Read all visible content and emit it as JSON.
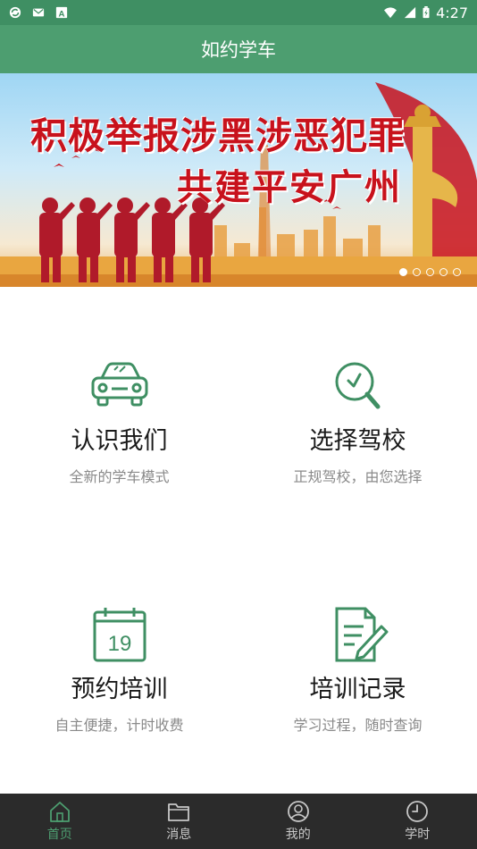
{
  "status_bar": {
    "left_icons": [
      "sync-icon",
      "mail-icon",
      "text-a-icon"
    ],
    "time": "4:27",
    "right_icons": [
      "wifi-icon",
      "signal-icon",
      "battery-icon"
    ]
  },
  "app_bar": {
    "title": "如约学车"
  },
  "banner": {
    "line1": "积极举报涉黑涉恶犯罪",
    "line2": "共建平安广州",
    "dot_count": 5,
    "active_dot_index": 0
  },
  "tiles": [
    {
      "icon": "car-icon",
      "title": "认识我们",
      "subtitle": "全新的学车模式"
    },
    {
      "icon": "search-icon",
      "title": "选择驾校",
      "subtitle": "正规驾校，由您选择"
    },
    {
      "icon": "calendar-icon",
      "title": "预约培训",
      "subtitle": "自主便捷，计时收费",
      "calendar_number": "19"
    },
    {
      "icon": "notes-icon",
      "title": "培训记录",
      "subtitle": "学习过程，随时查询"
    }
  ],
  "tab_bar": {
    "items": [
      {
        "icon": "home-icon",
        "label": "首页",
        "active": true
      },
      {
        "icon": "folder-icon",
        "label": "消息",
        "active": false
      },
      {
        "icon": "profile-icon",
        "label": "我的",
        "active": false
      },
      {
        "icon": "clock-icon",
        "label": "学时",
        "active": false
      }
    ]
  },
  "colors": {
    "primary": "#4d9e70",
    "status_bar": "#3f8f63",
    "icon_green": "#3f8f63",
    "tab_bar_bg": "#2b2b2b",
    "banner_red": "#c8121c"
  }
}
